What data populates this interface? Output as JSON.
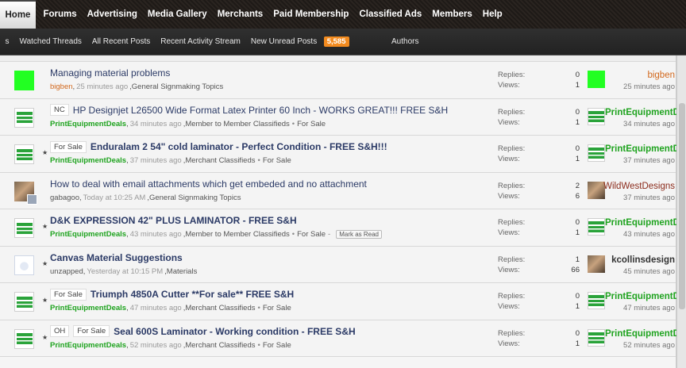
{
  "topnav": {
    "items": [
      "Home",
      "Forums",
      "Advertising",
      "Media Gallery",
      "Merchants",
      "Paid Membership",
      "Classified Ads",
      "Members",
      "Help"
    ]
  },
  "subnav": {
    "items": [
      "s",
      "Watched Threads",
      "All Recent Posts",
      "Recent Activity Stream",
      "New Unread Posts"
    ],
    "unread_count": "5,585",
    "authors": "Authors"
  },
  "labels": {
    "replies": "Replies:",
    "views": "Views:"
  },
  "colors": {
    "accent_orange": "#f38b1f",
    "author_green": "#1fa31f",
    "title_blue": "#2b3a66"
  },
  "threads": [
    {
      "avatar": "green-square",
      "prefix": "",
      "title": "Managing material problems",
      "bold": false,
      "sticky": false,
      "author": "bigben",
      "date": "25 minutes ago",
      "forum": "General Signmaking Topics",
      "extra": "",
      "markread": "",
      "replies": "0",
      "views": "1",
      "last_user": "bigben",
      "last_time": "25 minutes ago"
    },
    {
      "avatar": "pe",
      "prefix": "NC",
      "title": "HP Designjet L26500 Wide Format Latex Printer 60 Inch - WORKS GREAT!!! FREE S&H",
      "bold": false,
      "sticky": false,
      "author": "PrintEquipmentDeals",
      "date": "34 minutes ago",
      "forum": "Member to Member Classifieds",
      "extra": "For Sale",
      "markread": "",
      "replies": "0",
      "views": "1",
      "last_user": "PrintEquipmentDe",
      "last_time": "34 minutes ago"
    },
    {
      "avatar": "pe",
      "prefix": "For Sale",
      "title": "Enduralam 2 54\" cold laminator - Perfect Condition - FREE S&H!!!",
      "bold": true,
      "sticky": true,
      "author": "PrintEquipmentDeals",
      "date": "37 minutes ago",
      "forum": "Merchant Classifieds",
      "extra": "For Sale",
      "markread": "",
      "replies": "0",
      "views": "1",
      "last_user": "PrintEquipmentDe",
      "last_time": "37 minutes ago"
    },
    {
      "avatar": "person",
      "prefix": "",
      "title": "How to deal with email attachments which get embeded and no attachment",
      "bold": false,
      "sticky": false,
      "author": "gabagoo",
      "date": "Today at 10:25 AM",
      "forum": "General Signmaking Topics",
      "extra": "",
      "markread": "",
      "replies": "2",
      "views": "6",
      "last_user": "WildWestDesigns",
      "last_time": "37 minutes ago"
    },
    {
      "avatar": "pe",
      "prefix": "",
      "title": "D&K EXPRESSION 42\" PLUS LAMINATOR - FREE S&H",
      "bold": true,
      "sticky": true,
      "author": "PrintEquipmentDeals",
      "date": "43 minutes ago",
      "forum": "Member to Member Classifieds",
      "extra": "For Sale",
      "markread": "Mark as Read",
      "replies": "0",
      "views": "1",
      "last_user": "PrintEquipmentDe",
      "last_time": "43 minutes ago"
    },
    {
      "avatar": "plain",
      "prefix": "",
      "title": "Canvas Material Suggestions",
      "bold": true,
      "sticky": true,
      "author": "unzapped",
      "date": "Yesterday at 10:15 PM",
      "forum": "Materials",
      "extra": "",
      "markread": "",
      "replies": "1",
      "views": "66",
      "last_user": "kcollinsdesign",
      "last_time": "45 minutes ago"
    },
    {
      "avatar": "pe",
      "prefix": "For Sale",
      "title": "Triumph 4850A Cutter **For sale** FREE S&H",
      "bold": true,
      "sticky": true,
      "author": "PrintEquipmentDeals",
      "date": "47 minutes ago",
      "forum": "Merchant Classifieds",
      "extra": "For Sale",
      "markread": "",
      "replies": "0",
      "views": "1",
      "last_user": "PrintEquipmentDe",
      "last_time": "47 minutes ago"
    },
    {
      "avatar": "pe",
      "prefix": "OH",
      "prefix2": "For Sale",
      "title": "Seal 600S Laminator - Working condition - FREE S&H",
      "bold": true,
      "sticky": true,
      "author": "PrintEquipmentDeals",
      "date": "52 minutes ago",
      "forum": "Merchant Classifieds",
      "extra": "For Sale",
      "markread": "",
      "replies": "0",
      "views": "1",
      "last_user": "PrintEquipmentDe",
      "last_time": "52 minutes ago"
    }
  ]
}
